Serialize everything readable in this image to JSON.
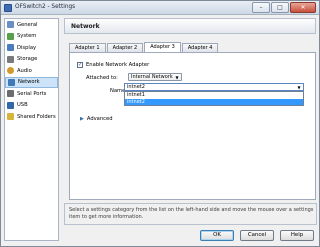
{
  "window": {
    "title": "OFSwitch2 - Settings",
    "controls": [
      "–",
      "□",
      "✕"
    ]
  },
  "sidebar": {
    "items": [
      {
        "label": "General",
        "icon": "general-icon",
        "color": "#6a8fc7"
      },
      {
        "label": "System",
        "icon": "system-icon",
        "color": "#59a04b"
      },
      {
        "label": "Display",
        "icon": "display-icon",
        "color": "#4c7cc0"
      },
      {
        "label": "Storage",
        "icon": "storage-icon",
        "color": "#7a7a7a"
      },
      {
        "label": "Audio",
        "icon": "audio-icon",
        "color": "#d19a2a"
      },
      {
        "label": "Network",
        "icon": "network-icon",
        "color": "#3f79b9",
        "selected": true
      },
      {
        "label": "Serial Ports",
        "icon": "serial-ports-icon",
        "color": "#6c6c6c"
      },
      {
        "label": "USB",
        "icon": "usb-icon",
        "color": "#2f67a8"
      },
      {
        "label": "Shared Folders",
        "icon": "shared-folders-icon",
        "color": "#d7b53c"
      }
    ]
  },
  "header": {
    "title": "Network"
  },
  "tabs": [
    {
      "label": "Adapter 1"
    },
    {
      "label": "Adapter 2"
    },
    {
      "label": "Adapter 3",
      "active": true
    },
    {
      "label": "Adapter 4"
    }
  ],
  "adapter": {
    "enable_label": "Enable Network Adapter",
    "enable_checked": "✓",
    "attached_label": "Attached to:",
    "attached_value": "Internal Network",
    "name_label": "Name:",
    "name_value": "intnet2",
    "name_options": [
      "intnet1",
      "intnet2"
    ],
    "name_highlighted": "intnet2",
    "advanced_label": "Advanced"
  },
  "info": {
    "text": "Select a settings category from the list on the left-hand side and move the mouse over a settings item to get more information."
  },
  "footer": {
    "ok": "OK",
    "cancel": "Cancel",
    "help": "Help"
  }
}
